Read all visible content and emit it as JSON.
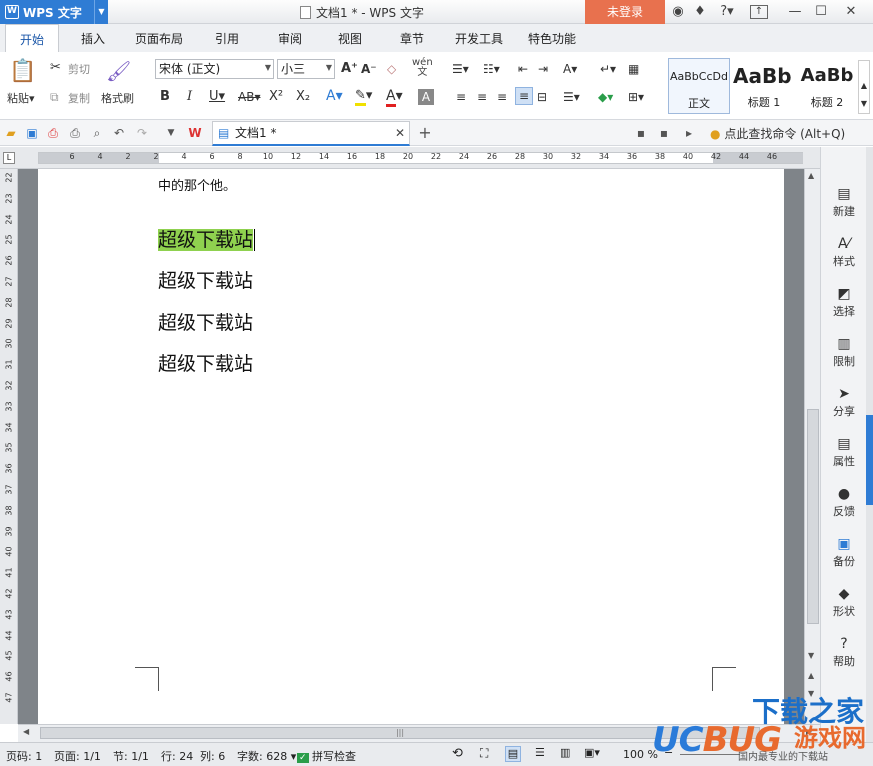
{
  "app": {
    "name": "WPS 文字",
    "doc_title": "文档1 * - WPS 文字",
    "login": "未登录"
  },
  "tabs": [
    "开始",
    "插入",
    "页面布局",
    "引用",
    "审阅",
    "视图",
    "章节",
    "开发工具",
    "特色功能"
  ],
  "ribbon": {
    "paste": "粘贴",
    "cut": "剪切",
    "copy": "复制",
    "format_painter": "格式刷",
    "font_name": "宋体 (正文)",
    "font_size": "小三",
    "styles": [
      {
        "preview": "AaBbCcDd",
        "name": "正文"
      },
      {
        "preview": "AaBb",
        "name": "标题 1"
      },
      {
        "preview": "AaBb",
        "name": "标题 2"
      }
    ]
  },
  "doc_tab": {
    "label": "文档1 *"
  },
  "search": {
    "label": "点此查找命令 (Alt+Q)"
  },
  "ruler": {
    "ticks": [
      "6",
      "4",
      "2",
      "2",
      "4",
      "6",
      "8",
      "10",
      "12",
      "14",
      "16",
      "18",
      "20",
      "22",
      "24",
      "26",
      "28",
      "30",
      "32",
      "34",
      "36",
      "38",
      "40",
      "42",
      "44",
      "46"
    ]
  },
  "vruler": {
    "ticks": [
      "22",
      "23",
      "24",
      "25",
      "26",
      "27",
      "28",
      "29",
      "30",
      "31",
      "32",
      "33",
      "34",
      "35",
      "36",
      "37",
      "38",
      "39",
      "40",
      "41",
      "42",
      "43",
      "44",
      "45",
      "46",
      "47"
    ]
  },
  "document": {
    "top_fragment": "中的那个他。",
    "lines": [
      "超级下载站",
      "超级下载站",
      "超级下载站",
      "超级下载站"
    ]
  },
  "sidebar": [
    {
      "icon": "new-icon",
      "label": "新建"
    },
    {
      "icon": "style-icon",
      "label": "样式"
    },
    {
      "icon": "select-icon",
      "label": "选择"
    },
    {
      "icon": "restrict-icon",
      "label": "限制"
    },
    {
      "icon": "share-icon",
      "label": "分享"
    },
    {
      "icon": "properties-icon",
      "label": "属性"
    },
    {
      "icon": "feedback-icon",
      "label": "反馈"
    },
    {
      "icon": "backup-icon",
      "label": "备份"
    },
    {
      "icon": "shape-icon",
      "label": "形状"
    },
    {
      "icon": "help-icon",
      "label": "帮助"
    }
  ],
  "status": {
    "page_no": "页码: 1",
    "page": "页面: 1/1",
    "section": "节: 1/1",
    "row": "行: 24",
    "col": "列: 6",
    "words": "字数: 628",
    "spell": "拼写检查",
    "zoom": "100 %",
    "note": "国内最专业的下载站"
  },
  "watermark": {
    "line1": "下载之家",
    "line2a": "UC",
    "line2b": "BUG",
    "line3": "游戏网"
  }
}
